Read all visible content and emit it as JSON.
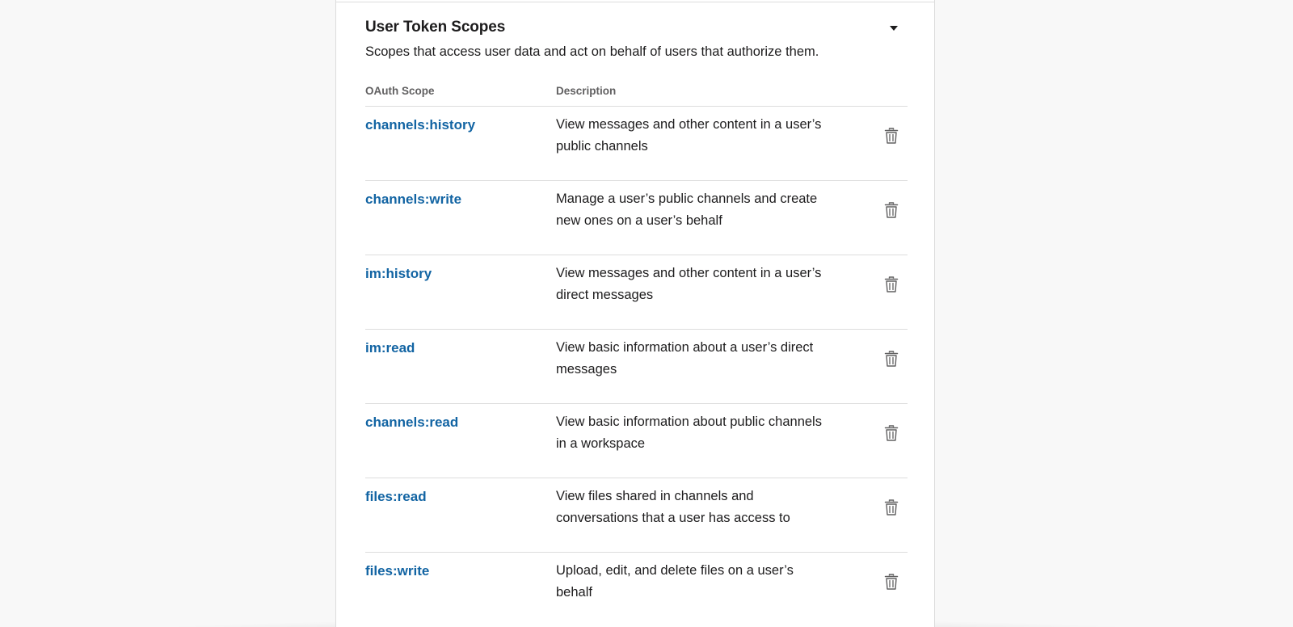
{
  "section": {
    "title": "User Token Scopes",
    "description": "Scopes that access user data and act on behalf of users that authorize them."
  },
  "table": {
    "columns": {
      "scope": "OAuth Scope",
      "description": "Description"
    },
    "rows": [
      {
        "scope": "channels:history",
        "description": "View messages and other content in a user’s public channels"
      },
      {
        "scope": "channels:write",
        "description": "Manage a user’s public channels and create new ones on a user’s behalf"
      },
      {
        "scope": "im:history",
        "description": "View messages and other content in a user’s direct messages"
      },
      {
        "scope": "im:read",
        "description": "View basic information about a user’s direct messages"
      },
      {
        "scope": "channels:read",
        "description": "View basic information about public channels in a workspace"
      },
      {
        "scope": "files:read",
        "description": "View files shared in channels and conversations that a user has access to"
      },
      {
        "scope": "files:write",
        "description": "Upload, edit, and delete files on a user’s behalf"
      }
    ]
  },
  "icons": {
    "collapse": "caret-down-icon",
    "delete": "trash-icon"
  },
  "colors": {
    "link": "#1264a3",
    "text": "#1d1c1d",
    "muted": "#616061",
    "background": "#f8f8f8"
  }
}
